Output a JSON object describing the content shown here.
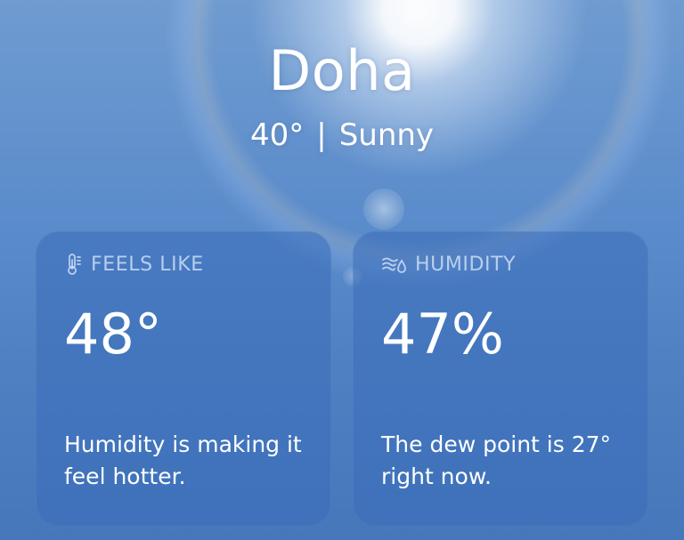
{
  "location": {
    "city": "Doha",
    "temperature": "40°",
    "separator": "|",
    "condition": "Sunny"
  },
  "cards": [
    {
      "icon": "thermometer-icon",
      "title": "FEELS LIKE",
      "value": "48°",
      "description": "Humidity is making it feel hotter."
    },
    {
      "icon": "humidity-icon",
      "title": "HUMIDITY",
      "value": "47%",
      "description": "The dew point is 27° right now."
    }
  ],
  "colors": {
    "sky_top": "#6f9bd0",
    "sky_bottom": "#4577ba",
    "card_background": "#3a6eb9",
    "header_text": "#d7e6fa",
    "text": "#ffffff"
  }
}
